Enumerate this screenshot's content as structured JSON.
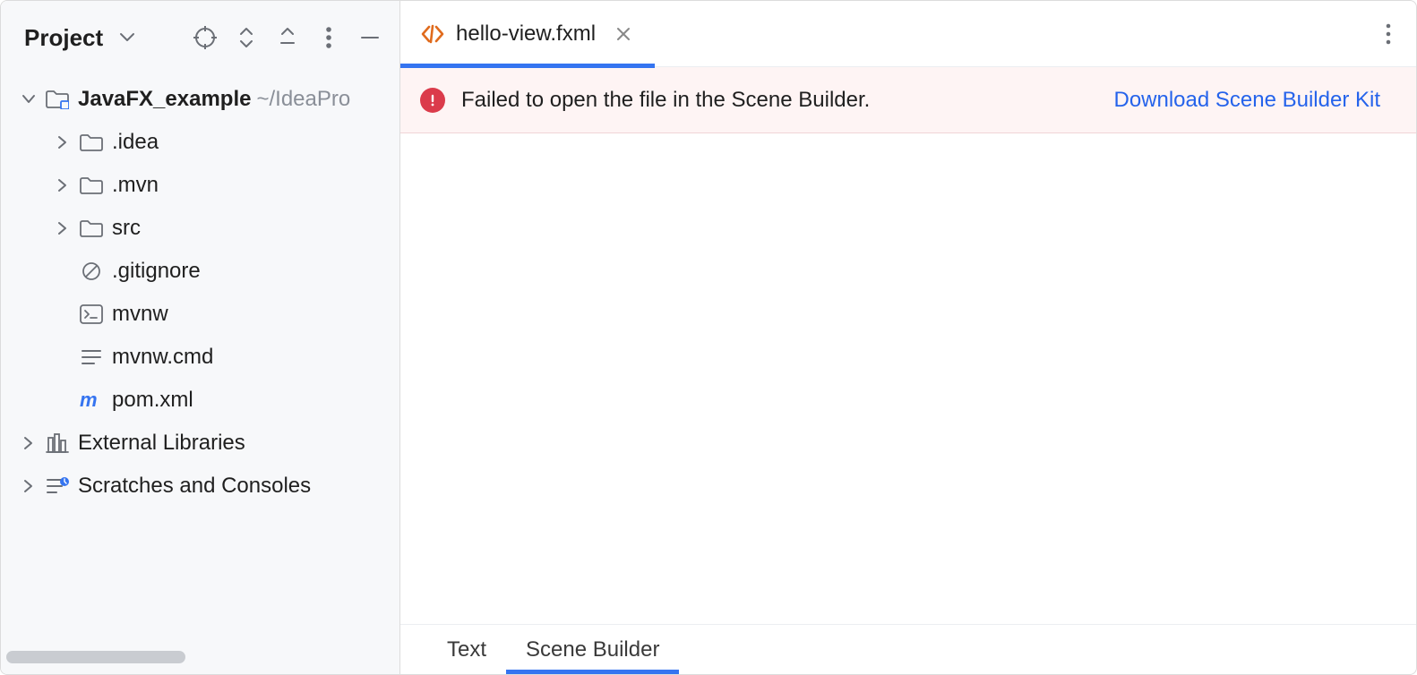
{
  "sidebar": {
    "title": "Project",
    "tree": [
      {
        "depth": 0,
        "arrow": "down",
        "icon": "module-folder",
        "label": "JavaFX_example",
        "secondary": "~/IdeaPro",
        "bold": true
      },
      {
        "depth": 1,
        "arrow": "right",
        "icon": "folder",
        "label": ".idea"
      },
      {
        "depth": 1,
        "arrow": "right",
        "icon": "folder",
        "label": ".mvn"
      },
      {
        "depth": 1,
        "arrow": "right",
        "icon": "folder",
        "label": "src"
      },
      {
        "depth": 1,
        "arrow": "none",
        "icon": "ignore",
        "label": ".gitignore"
      },
      {
        "depth": 1,
        "arrow": "none",
        "icon": "shell",
        "label": "mvnw"
      },
      {
        "depth": 1,
        "arrow": "none",
        "icon": "text",
        "label": "mvnw.cmd"
      },
      {
        "depth": 1,
        "arrow": "none",
        "icon": "maven",
        "label": "pom.xml"
      },
      {
        "depth": 0,
        "arrow": "right",
        "icon": "library",
        "label": "External Libraries"
      },
      {
        "depth": 0,
        "arrow": "right",
        "icon": "scratch",
        "label": "Scratches and Consoles"
      }
    ]
  },
  "editor": {
    "tab": {
      "label": "hello-view.fxml"
    },
    "banner": {
      "message": "Failed to open the file in the Scene Builder.",
      "link": "Download Scene Builder Kit"
    },
    "bottom_tabs": {
      "text": "Text",
      "scene_builder": "Scene Builder"
    }
  }
}
